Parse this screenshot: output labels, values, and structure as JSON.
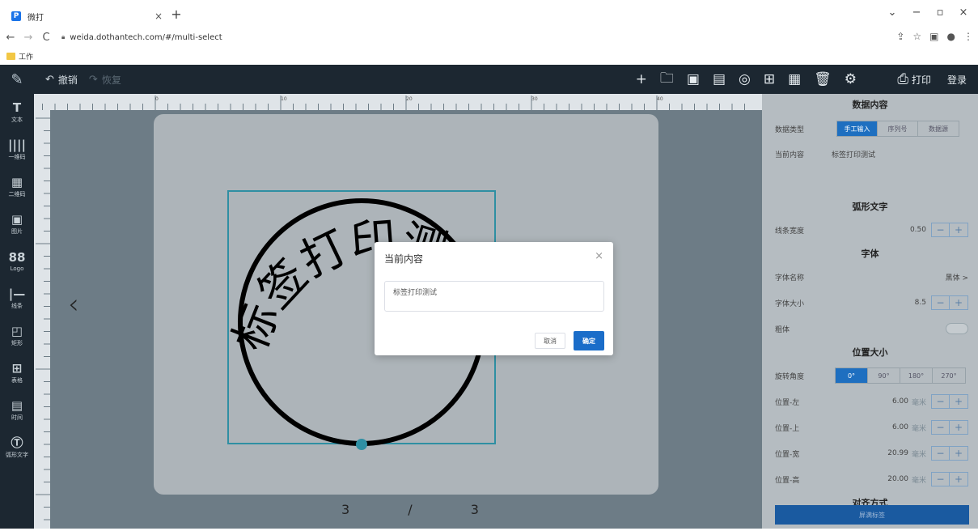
{
  "browser": {
    "tab_title": "微打",
    "tab_icon_letter": "P",
    "url": "weida.dothantech.com/#/multi-select",
    "bookmark": "工作"
  },
  "toolbar": {
    "undo": "撤销",
    "redo": "恢复",
    "print": "打印",
    "login": "登录"
  },
  "sidebar": {
    "items": [
      {
        "icon": "text-icon",
        "glyph": "T",
        "label": "文本"
      },
      {
        "icon": "barcode-icon",
        "glyph": "||||",
        "label": "一维码"
      },
      {
        "icon": "qrcode-icon",
        "glyph": "▦",
        "label": "二维码"
      },
      {
        "icon": "image-icon",
        "glyph": "▣",
        "label": "图片"
      },
      {
        "icon": "logo-icon",
        "glyph": "88",
        "label": "Logo"
      },
      {
        "icon": "line-icon",
        "glyph": "|—",
        "label": "线条"
      },
      {
        "icon": "rect-icon",
        "glyph": "◰",
        "label": "矩形"
      },
      {
        "icon": "table-icon",
        "glyph": "⊞",
        "label": "表格"
      },
      {
        "icon": "time-icon",
        "glyph": "▤",
        "label": "时间"
      },
      {
        "icon": "arc-text-icon",
        "glyph": "Ⓣ",
        "label": "弧形文字"
      }
    ]
  },
  "canvas": {
    "arc_text": "标签打印测试",
    "page_current": "3",
    "page_sep": "/",
    "page_total": "3",
    "ruler_labels": [
      "0",
      "10",
      "20",
      "30",
      "40"
    ]
  },
  "panel": {
    "data_header": "数据内容",
    "data_type_label": "数据类型",
    "data_type_options": [
      "手工输入",
      "序列号",
      "数据源"
    ],
    "current_content_label": "当前内容",
    "current_content_value": "标签打印测试",
    "arc_header": "弧形文字",
    "line_width_label": "线条宽度",
    "line_width_value": "0.50",
    "font_header": "字体",
    "font_name_label": "字体名称",
    "font_name_value": "黑体 >",
    "font_size_label": "字体大小",
    "font_size_value": "8.5",
    "bold_label": "粗体",
    "pos_header": "位置大小",
    "rotate_label": "旋转角度",
    "rotate_options": [
      "0°",
      "90°",
      "180°",
      "270°"
    ],
    "left_label": "位置-左",
    "left_value": "6.00",
    "top_label": "位置-上",
    "top_value": "6.00",
    "width_label": "位置-宽",
    "width_value": "20.99",
    "height_label": "位置-高",
    "height_value": "20.00",
    "unit": "毫米",
    "align_header": "对齐方式",
    "fill_label": "屏满标签"
  },
  "dialog": {
    "title": "当前内容",
    "input_value": "标签打印测试",
    "cancel": "取消",
    "ok": "确定"
  }
}
